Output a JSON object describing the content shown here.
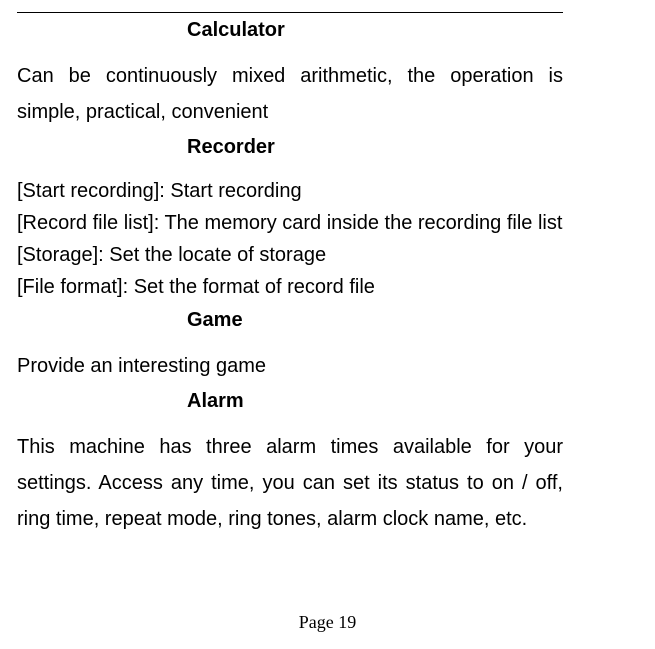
{
  "sections": [
    {
      "heading": "Calculator",
      "body": "Can be continuously mixed arithmetic, the operation is simple, practical, convenient"
    },
    {
      "heading": "Recorder",
      "lines": [
        "[Start recording]: Start recording",
        "[Record file list]: The memory card inside the recording file list",
        "[Storage]: Set the locate of storage",
        "[File format]: Set the format of record file"
      ]
    },
    {
      "heading": "Game",
      "body": "Provide an interesting game"
    },
    {
      "heading": "Alarm",
      "body": "This machine has three alarm times available for your settings. Access any time, you can set its status to on / off, ring time, repeat mode, ring tones, alarm clock name, etc."
    }
  ],
  "page_label": "Page 19"
}
